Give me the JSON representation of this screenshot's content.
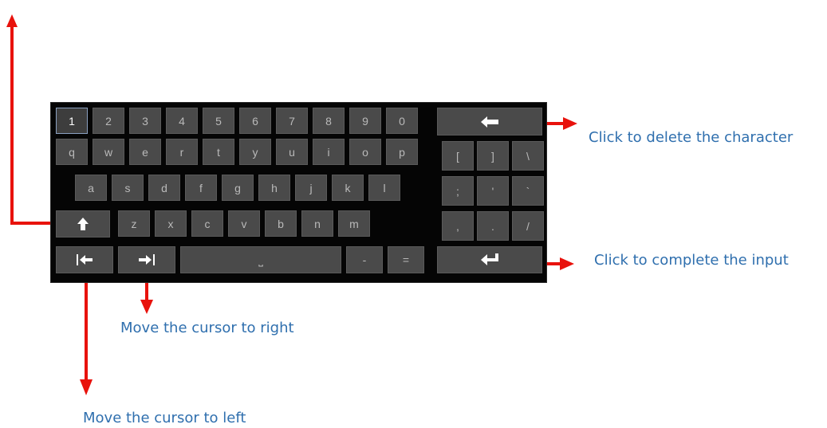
{
  "keyboard": {
    "row_numbers": [
      "1",
      "2",
      "3",
      "4",
      "5",
      "6",
      "7",
      "8",
      "9",
      "0"
    ],
    "row_q": [
      "q",
      "w",
      "e",
      "r",
      "t",
      "y",
      "u",
      "i",
      "o",
      "p"
    ],
    "row_a": [
      "a",
      "s",
      "d",
      "f",
      "g",
      "h",
      "j",
      "k",
      "l"
    ],
    "row_z": [
      "z",
      "x",
      "c",
      "v",
      "b",
      "n",
      "m"
    ],
    "row_bottom_symbols": [
      "-",
      "="
    ],
    "right_symbols_row1": [
      "[",
      "]",
      "\\"
    ],
    "right_symbols_row2": [
      ";",
      "'",
      "`"
    ],
    "right_symbols_row3": [
      ",",
      ".",
      "/"
    ],
    "space_glyph": "⎵",
    "icons": {
      "backspace": "backspace-arrow-icon",
      "shift": "shift-arrow-icon",
      "cursor_left": "cursor-left-icon",
      "cursor_right": "cursor-right-icon",
      "enter": "enter-icon"
    }
  },
  "annotations": {
    "backspace": "Click to delete the character",
    "enter": "Click to complete the input",
    "cursor_right": "Move the cursor to right",
    "cursor_left": "Move the cursor to left"
  },
  "colors": {
    "key_bg": "#4a4a4a",
    "keyboard_bg": "#050505",
    "arrow": "#e8120c",
    "annotation_text": "#2f6fae"
  }
}
